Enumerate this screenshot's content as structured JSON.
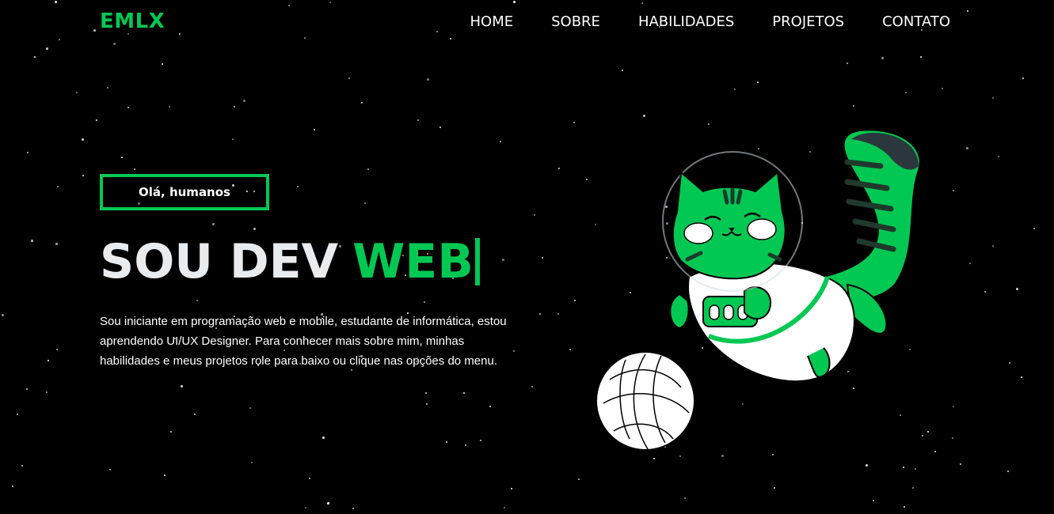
{
  "brand": {
    "logo_text": "EMLX"
  },
  "nav": {
    "items": [
      {
        "label": "HOME"
      },
      {
        "label": "SOBRE"
      },
      {
        "label": "HABILIDADES"
      },
      {
        "label": "PROJETOS"
      },
      {
        "label": "CONTATO"
      }
    ]
  },
  "hero": {
    "badge": "Olá, humanos",
    "headline_plain": "SOU DEV",
    "headline_accent": "WEB",
    "intro": "Sou iniciante em programação web e mobile, estudante de informática, estou aprendendo UI/UX Designer. Para conhecer mais sobre mim, minhas habilidades e meus projetos role para baixo ou clique nas opções do menu."
  },
  "illustration": {
    "icon": "astronaut-cat-with-yarn-ball-icon"
  },
  "colors": {
    "background": "#000000",
    "accent": "#00c853",
    "text": "#ffffff",
    "headline": "#e8ecef",
    "tail_tip": "#2b373d"
  }
}
